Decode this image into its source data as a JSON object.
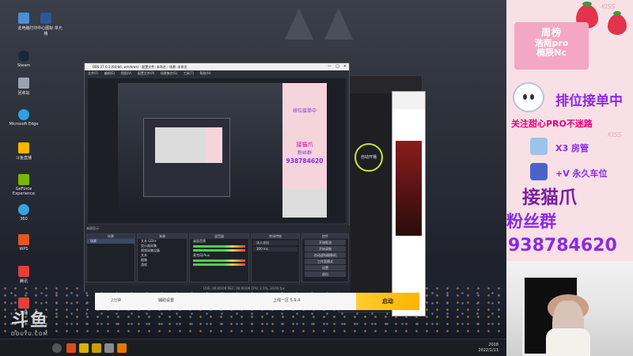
{
  "desktop": {
    "icons": [
      {
        "label": "此电脑",
        "color": "#4a90d9"
      },
      {
        "label": "打印中心图标\n单元格",
        "color": "#2b579a"
      },
      {
        "label": "Steam",
        "color": "#1b2838"
      },
      {
        "label": "回收站",
        "color": "#9aa4b0"
      },
      {
        "label": "Microsoft Edge",
        "color": "#2f9ee4"
      },
      {
        "label": "斗鱼直播",
        "color": "#ffb400"
      },
      {
        "label": "GeForce Experience",
        "color": "#76b900"
      },
      {
        "label": "360",
        "color": "#35a3de"
      },
      {
        "label": "WPS",
        "color": "#e4571e"
      },
      {
        "label": "腾讯",
        "color": "#e0403c"
      },
      {
        "label": "直播",
        "color": "#e0403c"
      }
    ],
    "watermark": {
      "brand": "斗鱼",
      "site": "DOUYU.COM"
    },
    "taskbar": {
      "time": "2018",
      "date": "2022/1/11"
    }
  },
  "obs": {
    "title": "OBS 27.0.1 (64-bit, windows) - 配置文件: 未命名 - 场景: 未命名",
    "menu": [
      "文件(F)",
      "编辑(E)",
      "视图(V)",
      "配置文件(P)",
      "场景集合(S)",
      "工具(T)",
      "帮助(H)"
    ],
    "dock_header": "来源显示",
    "panels": {
      "scenes": {
        "title": "场景",
        "items": [
          "场景"
        ]
      },
      "sources": {
        "title": "来源",
        "items": [
          "文本 GDI+",
          "显示器采集",
          "视频采集设备",
          "文本",
          "图像",
          "游戏"
        ]
      },
      "mixer": {
        "title": "混音器",
        "items": [
          "桌面音频",
          "麦克风/Aux"
        ]
      },
      "transitions": {
        "title": "转场特效",
        "items": [
          "淡入淡出",
          "300 ms"
        ]
      },
      "controls": {
        "title": "控件",
        "buttons": [
          "开始推流",
          "开始录制",
          "启动虚拟摄像机",
          "工作室模式",
          "设置",
          "退出"
        ]
      }
    },
    "status": "LIVE: 00:00:00   REC: 00:00:00   CPU: 2.1%, 30.00 fps"
  },
  "preview_overlay": {
    "title": "周榜",
    "orders": "排位接单中",
    "follow": "关注甜心PRO不迷路",
    "claw": "接猫爪",
    "fans": "粉丝群",
    "number": "938784620"
  },
  "app": {
    "round_button": "自动开播",
    "bottom_left": "2分钟",
    "bottom_settings": "辅助设置",
    "bottom_version": "上线一区 5.9.4",
    "start": "启动"
  },
  "overlay": {
    "board_title": "周榜",
    "board_lines": [
      "浩南pro",
      "楠辰Nc"
    ],
    "orders": "排位接单中",
    "follow": "关注甜心PRO不迷路",
    "gift1": "X3 房管",
    "gift2": "+V 永久车位",
    "claw": "接猫爪",
    "fans": "粉丝群",
    "number": "938784620",
    "kiss": "KISS",
    "colors": {
      "pink_bg": "#f8e0e6",
      "purple": "#8a2be2",
      "magenta": "#e6007a"
    }
  }
}
